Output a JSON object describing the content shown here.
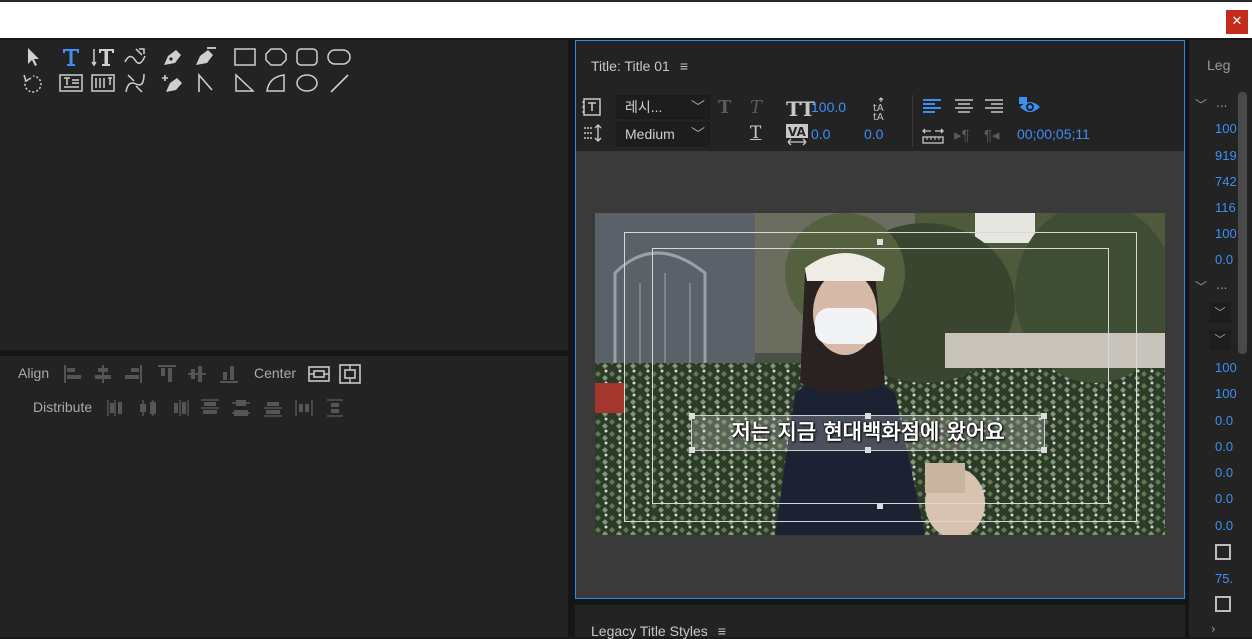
{
  "window": {
    "close_glyph": "✕"
  },
  "align": {
    "align_label": "Align",
    "center_label": "Center",
    "distribute_label": "Distribute"
  },
  "title_panel": {
    "header": "Title: Title 01",
    "font_family": "레시...",
    "font_style": "Medium",
    "font_size": "100.0",
    "kerning": "0.0",
    "leading": "0.0",
    "timecode": "00;00;05;11",
    "subtitle_text": "저는 지금 현대백화점에 왔어요"
  },
  "styles_panel": {
    "header": "Legacy Title Styles"
  },
  "properties": {
    "header": "Leg",
    "values": [
      "100",
      "919",
      "742",
      "116",
      "100",
      "0.0"
    ],
    "values2": [
      "100",
      "100",
      "0.0",
      "0.0",
      "0.0",
      "0.0",
      "0.0"
    ],
    "last_value": "75."
  }
}
